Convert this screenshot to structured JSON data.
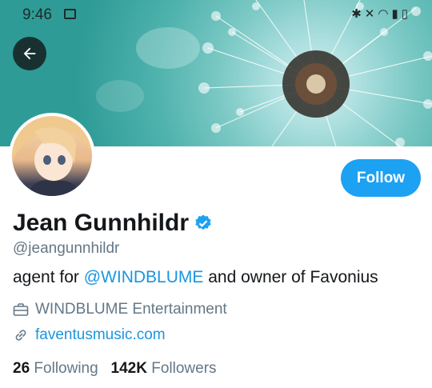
{
  "status_bar": {
    "time": "9:46",
    "image_icon": "image-icon",
    "right_icons": [
      "bluetooth-icon",
      "mute-icon",
      "wifi-icon",
      "signal-icon",
      "battery-icon"
    ]
  },
  "header": {
    "back_icon": "arrow-left-icon"
  },
  "profile": {
    "follow_label": "Follow",
    "name": "Jean Gunnhildr",
    "handle": "@jeangunnhildr",
    "bio_prefix": "agent for ",
    "bio_mention": "@WINDBLUME",
    "bio_suffix": " and owner of Favonius",
    "organization": "WINDBLUME Entertainment",
    "website": "faventusmusic.com",
    "following_count": "26",
    "following_label": "Following",
    "followers_count": "142K",
    "followers_label": "Followers"
  },
  "colors": {
    "accent": "#1da1f2",
    "link": "#1b95e0",
    "secondary_text": "#657786",
    "primary_text": "#14171a"
  }
}
